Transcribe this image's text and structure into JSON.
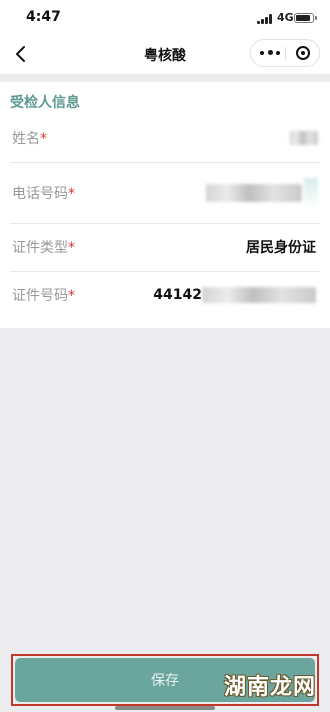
{
  "status_bar": {
    "time": "4:47",
    "network": "4G",
    "battery_level": 0.85
  },
  "nav": {
    "title": "粤核酸",
    "back_icon": "chevron-left-icon",
    "more_icon": "more-dots-icon",
    "target_icon": "target-icon"
  },
  "section": {
    "title": "受检人信息"
  },
  "fields": {
    "name": {
      "label": "姓名",
      "required": "*"
    },
    "phone": {
      "label": "电话号码",
      "required": "*"
    },
    "id_type": {
      "label": "证件类型",
      "required": "*",
      "value": "居民身份证"
    },
    "id_number": {
      "label": "证件号码",
      "required": "*",
      "value": "44142"
    }
  },
  "save": {
    "label": "保存"
  },
  "watermark": {
    "text": "湖南龙网"
  },
  "colors": {
    "accent": "#6aa69d",
    "section_title": "#5e9a92",
    "required": "#dd3333",
    "highlight_box": "#c0392b"
  }
}
